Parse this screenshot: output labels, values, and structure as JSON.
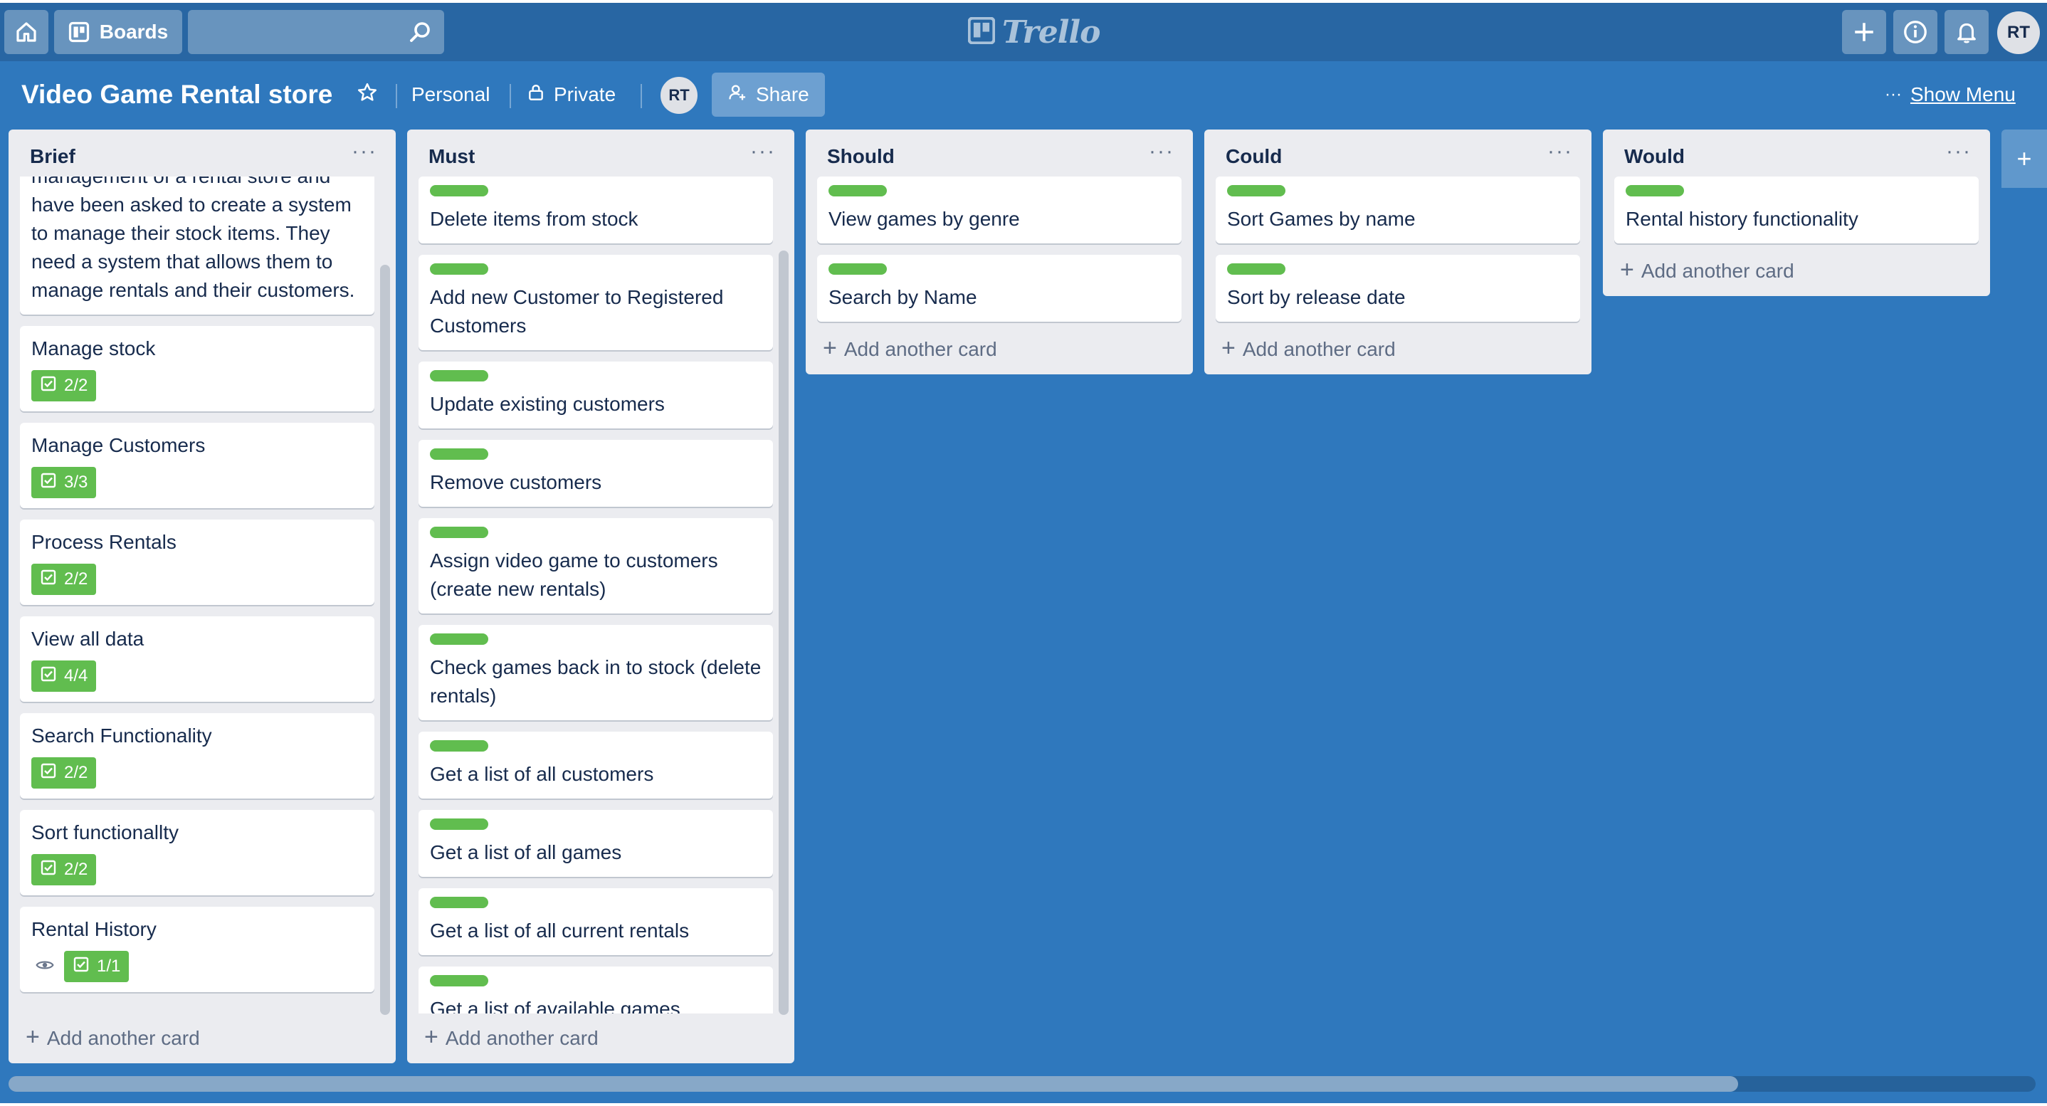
{
  "header": {
    "boards_label": "Boards",
    "search_value": "",
    "logo_text": "Trello",
    "avatar_initials": "RT"
  },
  "board": {
    "title": "Video Game Rental store",
    "team": "Personal",
    "visibility": "Private",
    "member_initials": "RT",
    "share_label": "Share",
    "show_menu_label": "Show Menu",
    "more_label": "···"
  },
  "colors": {
    "board_bg": "#2f78bd",
    "header_bg": "#2866a3",
    "list_bg": "#ebecf0",
    "label_green": "#61bd4f"
  },
  "lists": [
    {
      "title": "Brief",
      "add_card_label": "Add another card",
      "description_card": "management of a rental store and have been asked to create a system to manage their stock items. They need a system that allows them to manage rentals and their customers.",
      "cards": [
        {
          "title": "Manage stock",
          "checklist": "2/2",
          "watching": false
        },
        {
          "title": "Manage Customers",
          "checklist": "3/3",
          "watching": false
        },
        {
          "title": "Process Rentals",
          "checklist": "2/2",
          "watching": false
        },
        {
          "title": "View all data",
          "checklist": "4/4",
          "watching": false
        },
        {
          "title": "Search Functionality",
          "checklist": "2/2",
          "watching": false
        },
        {
          "title": "Sort functionallty",
          "checklist": "2/2",
          "watching": false
        },
        {
          "title": "Rental History",
          "checklist": "1/1",
          "watching": true
        }
      ]
    },
    {
      "title": "Must",
      "add_card_label": "Add another card",
      "cards": [
        {
          "title": "Delete items from stock"
        },
        {
          "title": "Add new Customer to Registered Customers"
        },
        {
          "title": "Update existing customers"
        },
        {
          "title": "Remove customers"
        },
        {
          "title": "Assign video game to customers (create new rentals)"
        },
        {
          "title": "Check games back in to stock (delete rentals)"
        },
        {
          "title": "Get a list of all customers"
        },
        {
          "title": "Get a list of all games"
        },
        {
          "title": "Get a list of all current rentals"
        },
        {
          "title": "Get a list of available games"
        }
      ]
    },
    {
      "title": "Should",
      "add_card_label": "Add another card",
      "cards": [
        {
          "title": "View games by genre"
        },
        {
          "title": "Search by Name"
        }
      ]
    },
    {
      "title": "Could",
      "add_card_label": "Add another card",
      "cards": [
        {
          "title": "Sort Games by name"
        },
        {
          "title": "Sort by release date"
        }
      ]
    },
    {
      "title": "Would",
      "add_card_label": "Add another card",
      "cards": [
        {
          "title": "Rental history functionality"
        }
      ]
    }
  ]
}
